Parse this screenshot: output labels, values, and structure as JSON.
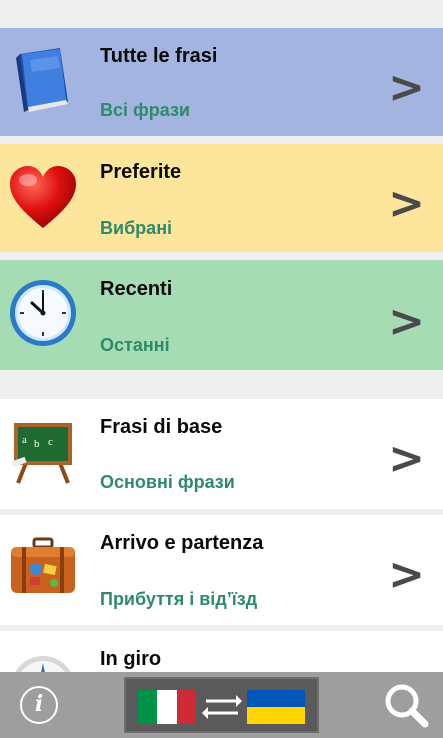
{
  "menu": [
    {
      "title": "Tutte le frasi",
      "subtitle": "Всі фрази",
      "icon": "book-icon",
      "bg": "#a4b4e0"
    },
    {
      "title": "Preferite",
      "subtitle": "Вибрані",
      "icon": "heart-icon",
      "bg": "#fde59b"
    },
    {
      "title": "Recenti",
      "subtitle": "Останні",
      "icon": "clock-icon",
      "bg": "#a6dcb4"
    },
    {
      "title": "Frasi di base",
      "subtitle": "Основні фрази",
      "icon": "chalkboard-icon",
      "bg": "#ffffff"
    },
    {
      "title": "Arrivo e partenza",
      "subtitle": "Прибуття і від’їзд",
      "icon": "suitcase-icon",
      "bg": "#ffffff"
    },
    {
      "title": "In giro",
      "subtitle": "",
      "icon": "compass-icon",
      "bg": "#ffffff"
    }
  ],
  "chevron": ">",
  "bottom_bar": {
    "info_label": "i",
    "source_flag": "italy-flag-icon",
    "target_flag": "ukraine-flag-icon",
    "swap_icon": "swap-arrows-icon",
    "search_icon": "search-icon"
  },
  "colors": {
    "subtitle": "#2f8a6a",
    "bottom_bar": "#9e9e9e",
    "language_button": "#5a5a5a"
  }
}
